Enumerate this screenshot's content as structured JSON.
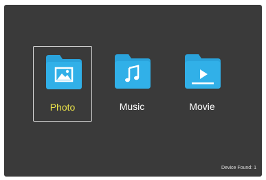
{
  "menu": {
    "items": [
      {
        "label": "Photo",
        "icon": "photo-folder-icon",
        "selected": true
      },
      {
        "label": "Music",
        "icon": "music-folder-icon",
        "selected": false
      },
      {
        "label": "Movie",
        "icon": "movie-folder-icon",
        "selected": false
      }
    ]
  },
  "status": {
    "device_found": "Device Found:  1"
  },
  "colors": {
    "background": "#3a3a3a",
    "folder": "#2aa3dc",
    "selected_label": "#e8e04a",
    "label": "#ffffff"
  }
}
